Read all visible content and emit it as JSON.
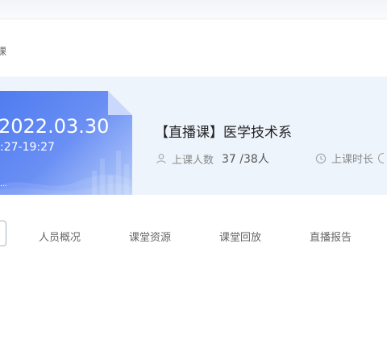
{
  "breadcrumb": {
    "current": "课"
  },
  "course": {
    "cover": {
      "date": "2022.03.30",
      "time": ":27-19:27",
      "tag": "..."
    },
    "title": "【直播课】医学技术系",
    "attendance": {
      "label": "上课人数",
      "value": "37 /38人"
    },
    "duration": {
      "label": "上课时长"
    }
  },
  "tabs": [
    {
      "label": "人员概况"
    },
    {
      "label": "课堂资源"
    },
    {
      "label": "课堂回放"
    },
    {
      "label": "直播报告"
    }
  ],
  "colors": {
    "card_bg": "#eef4fc",
    "cover_blue": "#4f7cf0",
    "muted_text": "#888888"
  },
  "icons": {
    "attendance": "person-icon",
    "duration": "clock-icon"
  }
}
